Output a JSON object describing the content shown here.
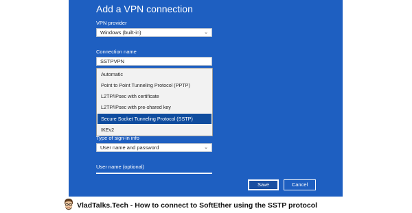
{
  "dialog": {
    "title": "Add a VPN connection",
    "vpn_provider_label": "VPN provider",
    "vpn_provider_value": "Windows (built-in)",
    "connection_name_label": "Connection name",
    "connection_name_value": "SSTPVPN",
    "vpn_type_dropdown": {
      "options": [
        "Automatic",
        "Point to Point Tunneling Protocol (PPTP)",
        "L2TP/IPsec with certificate",
        "L2TP/IPsec with pre-shared key",
        "Secure Socket Tunneling Protocol (SSTP)",
        "IKEv2"
      ],
      "selected": "Secure Socket Tunneling Protocol (SSTP)"
    },
    "sign_in_type_label": "Type of sign-in info",
    "sign_in_type_value": "User name and password",
    "username_label": "User name (optional)",
    "save_label": "Save",
    "cancel_label": "Cancel",
    "background_color": "#1e5fc1",
    "highlight_color": "#0f4c9e"
  },
  "caption": {
    "text": "VladTalks.Tech - How to connect to SoftEther using the SSTP protocol",
    "avatar_icon": "cartoon-avatar-icon"
  }
}
